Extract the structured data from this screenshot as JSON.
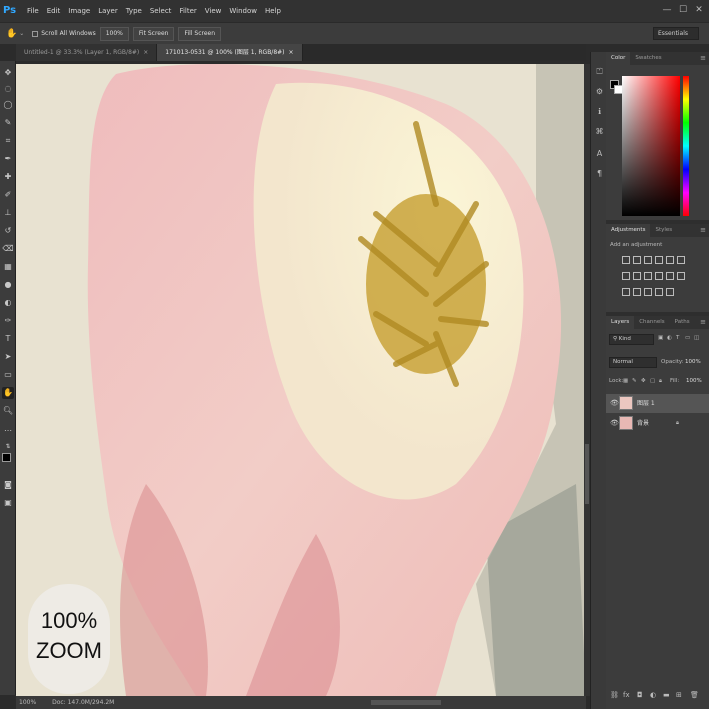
{
  "app": {
    "logo": "Ps"
  },
  "menu": [
    "File",
    "Edit",
    "Image",
    "Layer",
    "Type",
    "Select",
    "Filter",
    "View",
    "Window",
    "Help"
  ],
  "window_controls": {
    "minimize": "—",
    "maximize": "☐",
    "close": "✕"
  },
  "options_bar": {
    "scroll_all_windows": "Scroll All Windows",
    "btn_100": "100%",
    "btn_fit": "Fit Screen",
    "btn_fill": "Fill Screen",
    "workspace": "Essentials"
  },
  "tabs": [
    {
      "label": "Untitled-1 @ 33.3% (Layer 1, RGB/8#)",
      "close": "×"
    },
    {
      "label": "171013-0531 @ 100% (图层 1, RGB/8#)",
      "close": "×"
    }
  ],
  "status": {
    "zoom": "100%",
    "doc": "Doc: 147.0M/294.2M"
  },
  "zoom_badge": {
    "line1": "100%",
    "line2": "ZOOM"
  },
  "color_panel": {
    "tab_color": "Color",
    "tab_swatches": "Swatches",
    "menu": "≡"
  },
  "adjustments_panel": {
    "tab_adjustments": "Adjustments",
    "tab_styles": "Styles",
    "add_label": "Add an adjustment",
    "menu": "≡"
  },
  "layers_panel": {
    "tab_layers": "Layers",
    "tab_channels": "Channels",
    "tab_paths": "Paths",
    "menu": "≡",
    "filter_kind": "Kind",
    "blend_mode": "Normal",
    "opacity_label": "Opacity:",
    "opacity_value": "100%",
    "lock_label": "Lock:",
    "fill_label": "Fill:",
    "fill_value": "100%",
    "layers": [
      {
        "name": "图层 1"
      },
      {
        "name": "背景"
      }
    ]
  },
  "colors": {
    "accent": "#31a8ff",
    "panel_bg": "#3c3c3c",
    "app_bg": "#2b2b2b"
  }
}
